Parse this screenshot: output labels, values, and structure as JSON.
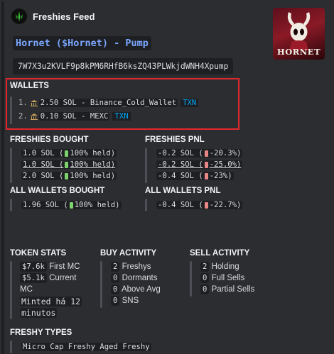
{
  "author": {
    "name": "Freshies Feed",
    "icon": "dagger-icon"
  },
  "title": "Hornet ($Hornet) - Pump",
  "contract_address": "7W7X3u2KVLF9p8kPM6RHfB6ksZQ43PLWkjdWNH4Xpump",
  "thumbnail_text": "HORNET",
  "wallets": {
    "header": "WALLETS",
    "items": [
      {
        "index": "1.",
        "text": "2.50 SOL - Binance_Cold_Wallet",
        "txn": "TXN"
      },
      {
        "index": "2.",
        "text": "0.10 SOL - MEXC",
        "txn": "TXN"
      }
    ]
  },
  "freshies_bought": {
    "header": "FRESHIES BOUGHT",
    "rows": [
      {
        "amount": "1.0 SOL (",
        "pct": "100% held)"
      },
      {
        "amount": "1.0 SOL (",
        "pct": "100% held)"
      },
      {
        "amount": "2.0 SOL (",
        "pct": "100% held)"
      }
    ]
  },
  "freshies_pnl": {
    "header": "FRESHIES PNL",
    "rows": [
      {
        "amount": "-0.2 SOL (",
        "pct": "-20.3%)"
      },
      {
        "amount": "-0.2 SOL (",
        "pct": "-25.0%)"
      },
      {
        "amount": "-0.4 SOL (",
        "pct": "-23%)"
      }
    ]
  },
  "all_wallets_bought": {
    "header": "ALL WALLETS BOUGHT",
    "amount": "1.96 SOL (",
    "pct": "100% held)"
  },
  "all_wallets_pnl": {
    "header": "ALL WALLETS PNL",
    "amount": "-0.4 SOL (",
    "pct": "-22.7%)"
  },
  "token_stats": {
    "header": "TOKEN STATS",
    "first_mc_value": "$7.6k",
    "first_mc_label": "First MC",
    "current_mc_value": "$5.1k",
    "current_mc_label_1": "Current",
    "current_mc_label_2": "MC",
    "minted_1": "Minted há 12",
    "minted_2": "minutos"
  },
  "buy_activity": {
    "header": "BUY ACTIVITY",
    "rows": [
      {
        "num": "2",
        "label": "Freshys"
      },
      {
        "num": "0",
        "label": "Dormants"
      },
      {
        "num": "0",
        "label": "Above Avg"
      },
      {
        "num": "0",
        "label": "SNS"
      }
    ]
  },
  "sell_activity": {
    "header": "SELL ACTIVITY",
    "rows": [
      {
        "num": "2",
        "label": "Holding"
      },
      {
        "num": "0",
        "label": "Full Sells"
      },
      {
        "num": "0",
        "label": "Partial Sells"
      }
    ]
  },
  "freshy_types": {
    "header": "FRESHY TYPES",
    "value": "Micro Cap Freshy Aged Freshy"
  },
  "colors": {
    "background": "#2b2d31",
    "code_background": "#1e1f22",
    "title_link": "#7aa6ff",
    "txn_link": "#00a8fc",
    "highlight_border": "#e3282c"
  }
}
